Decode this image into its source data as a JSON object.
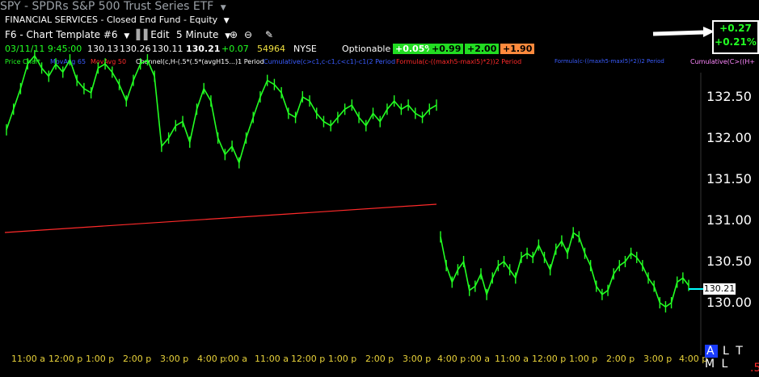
{
  "header": {
    "title": "SPY - SPDRs S&P 500 Trust Series ETF",
    "subtitle": "FINANCIAL SERVICES - Closed End Fund - Equity",
    "chart_template": "F6 - Chart Template #6",
    "edit_label": "Edit",
    "interval": "5 Minute",
    "zoom_in_icon": "zoom-in-icon",
    "zoom_out_icon": "zoom-out-icon",
    "draw_icon": "draw-pen-icon"
  },
  "quote": {
    "datetime": "03/11/11 9:45:00",
    "open": "130.13",
    "high": "130.26",
    "low": "130.11",
    "close": "130.21",
    "change": "+0.07",
    "volume": "54964",
    "exchange": "NYSE",
    "optionable_label": "Optionable",
    "chip_1": "+0.05%",
    "chip_2": "+0.99",
    "chip_3": "+2.00",
    "chip_4": "+1.90"
  },
  "studies": [
    "Price Chart",
    "MovAvg 65",
    "MovAvg 50",
    "Channel(c,H-(.5*(.5*(avgH15...)1 Period",
    "Cumulative(c>c1,c-c1,c<c1)-c1(2 Period",
    "Formula(c-((maxh5-maxl5)*2))2 Period",
    "Formula(c-((maxh5-maxl5)*2))2 Period",
    "Cumulative(C>((H+"
  ],
  "change_box": {
    "points": "+0.27",
    "percent": "+0.21%"
  },
  "price_axis": [
    "132.50",
    "132.00",
    "131.50",
    "131.00",
    "130.50",
    "130.00"
  ],
  "current_price_tag": "130.21",
  "time_axis": [
    "11:00 a",
    "12:00 p",
    "1:00 p",
    "2:00 p",
    "3:00 p",
    "4:00 p",
    ":00 a",
    "11:00 a",
    "12:00 p",
    "1:00 p",
    "2:00 p",
    "3:00 p",
    "4:00 p",
    ":00 a",
    "11:00 a",
    "12:00 p",
    "1:00 p",
    "2:00 p",
    "3:00 p",
    "4:00 p"
  ],
  "bottom_right": {
    "a": "A",
    "rest": "L T M L",
    "red_mark": ".5"
  },
  "colors": {
    "up": "#22ff22",
    "ma_line": "#ff2a2a",
    "accent": "#1a3cff"
  },
  "chart_data": {
    "type": "line",
    "series": [
      {
        "values": [
          132.1,
          132.35,
          132.6,
          132.9,
          133.0,
          132.85,
          132.75,
          132.9,
          132.8,
          132.95,
          132.7,
          132.6,
          132.55,
          132.85,
          132.9,
          132.8,
          132.65,
          132.45,
          132.7,
          132.9,
          132.95,
          132.75,
          131.9,
          132.0,
          132.15,
          132.2,
          131.95,
          132.35,
          132.6,
          132.45,
          132.0,
          131.8,
          131.9,
          131.7,
          132.0,
          132.25,
          132.5,
          132.7,
          132.65,
          132.55,
          132.3,
          132.25,
          132.5,
          132.45,
          132.3,
          132.2,
          132.15,
          132.25,
          132.35,
          132.4,
          132.25,
          132.15,
          132.3,
          132.2,
          132.35,
          132.45,
          132.35,
          132.4,
          132.3,
          132.25,
          132.35,
          132.4
        ]
      },
      {
        "values": [
          130.8,
          130.45,
          130.25,
          130.4,
          130.5,
          130.15,
          130.2,
          130.35,
          130.1,
          130.3,
          130.45,
          130.5,
          130.4,
          130.3,
          130.55,
          130.6,
          130.55,
          130.7,
          130.55,
          130.4,
          130.65,
          130.75,
          130.6,
          130.85,
          130.8,
          130.6,
          130.45,
          130.2,
          130.1,
          130.15,
          130.35,
          130.45,
          130.5,
          130.6,
          130.55,
          130.45,
          130.3,
          130.2,
          130.0,
          129.95,
          130.0,
          130.25,
          130.3,
          130.21
        ]
      }
    ]
  }
}
